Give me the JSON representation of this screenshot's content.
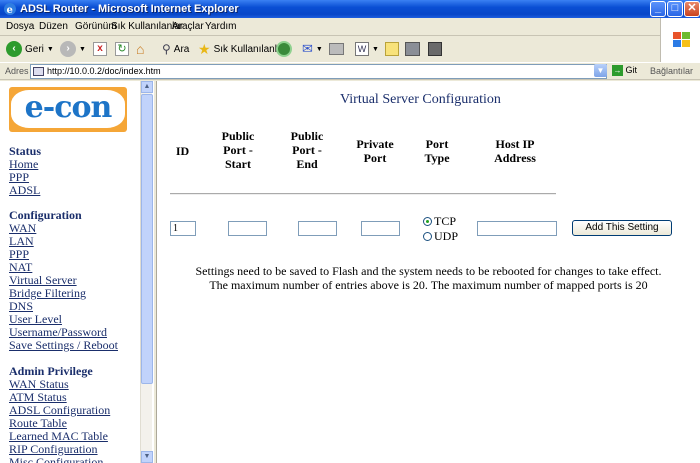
{
  "window": {
    "title": "ADSL Router - Microsoft Internet Explorer",
    "minimize": "_",
    "maximize": "□",
    "close": "✕"
  },
  "menu": [
    "Dosya",
    "Düzen",
    "Görünüm",
    "Sık Kullanılanlar",
    "Araçlar",
    "Yardım"
  ],
  "toolbar": {
    "back": "Geri",
    "search": "Ara",
    "favorites": "Sık Kullanılanlar"
  },
  "address": {
    "label": "Adres",
    "url": "http://10.0.0.2/doc/index.htm",
    "go": "Git",
    "links": "Bağlantılar"
  },
  "logo": "e-con",
  "sidebar": {
    "status_heading": "Status",
    "status_items": [
      "Home",
      "PPP",
      "ADSL"
    ],
    "config_heading": "Configuration",
    "config_items": [
      "WAN",
      "LAN",
      "PPP",
      "NAT",
      "Virtual Server",
      "Bridge Filtering",
      "DNS",
      "User Level",
      "Username/Password",
      "Save Settings / Reboot"
    ],
    "admin_heading": "Admin Privilege",
    "admin_items": [
      "WAN Status",
      "ATM Status",
      "ADSL Configuration",
      "Route Table",
      "Learned MAC Table",
      "RIP Configuration",
      "Misc Configuration"
    ]
  },
  "page": {
    "title": "Virtual Server Configuration",
    "headers": {
      "id": "ID",
      "pub_start": "Public Port - Start",
      "pub_end": "Public Port - End",
      "private": "Private Port",
      "type": "Port Type",
      "host": "Host IP Address"
    },
    "form": {
      "id_value": "1",
      "pub_start": "",
      "pub_end": "",
      "private": "",
      "host": "",
      "tcp": "TCP",
      "udp": "UDP",
      "selected": "TCP"
    },
    "add_button": "Add This Setting",
    "note1": "Settings need to be saved to Flash and the system needs to be rebooted for changes to take effect.",
    "note2": "The maximum number of entries above is 20. The maximum number of mapped ports is 20"
  }
}
